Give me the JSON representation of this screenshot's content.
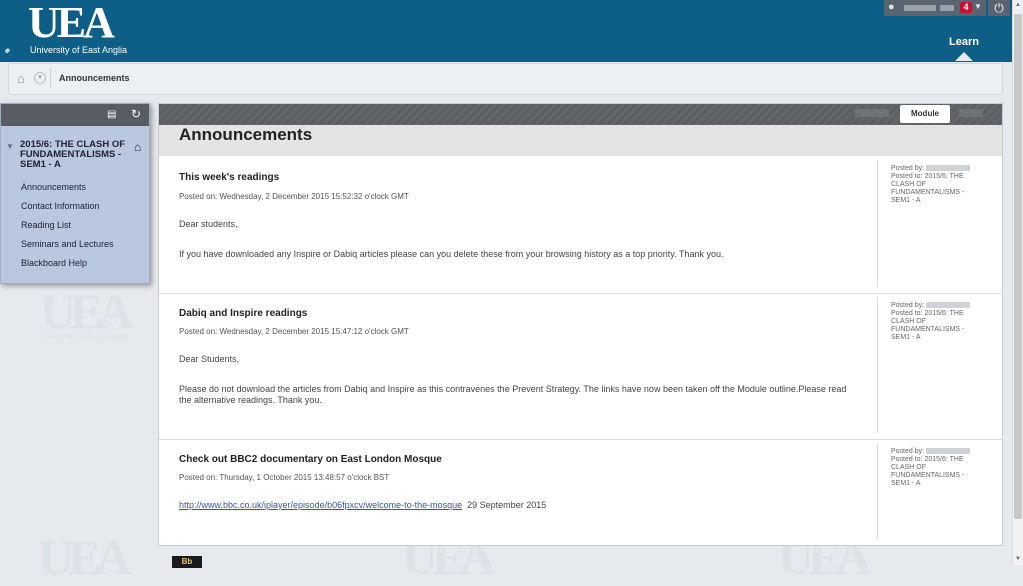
{
  "header": {
    "logo_text": "UEA",
    "logo_sub": "University of East Anglia",
    "notification_count": "4",
    "learn_tab": "Learn"
  },
  "breadcrumb": {
    "current": "Announcements"
  },
  "course_menu": {
    "course_title": "2015/6: THE CLASH OF FUNDAMENTALISMS - SEM1 - A",
    "items": [
      {
        "label": "Announcements"
      },
      {
        "label": "Contact Information"
      },
      {
        "label": "Reading List"
      },
      {
        "label": "Seminars and Lectures"
      },
      {
        "label": "Blackboard Help"
      }
    ]
  },
  "content": {
    "tab_module": "Module",
    "page_title": "Announcements",
    "announcements": [
      {
        "title": "This week's readings",
        "posted_on": "Posted on: Wednesday, 2 December 2015 15:52:32 o'clock GMT",
        "body": [
          "Dear students,",
          "If you have downloaded any Inspire or Dabiq articles please can you delete these from your browsing history as a top priority. Thank you."
        ],
        "posted_by_label": "Posted by:",
        "posted_to": "Posted to: 2015/6: THE CLASH OF FUNDAMENTALISMS - SEM1 - A"
      },
      {
        "title": "Dabiq and Inspire readings",
        "posted_on": "Posted on: Wednesday, 2 December 2015 15:47:12 o'clock GMT",
        "body": [
          "Dear Students,",
          "Please do not download the articles from Dabiq and Inspire as this contravenes the Prevent Strategy. The links have now been taken off the Module outline.Please read the alternative readings. Thank you."
        ],
        "posted_by_label": "Posted by:",
        "posted_to": "Posted to: 2015/6: THE CLASH OF FUNDAMENTALISMS - SEM1 - A"
      },
      {
        "title": "Check out BBC2 documentary on East London Mosque",
        "posted_on": "Posted on: Thursday, 1 October 2015 13:48:57 o'clock BST",
        "link": "http://www.bbc.co.uk/iplayer/episode/b06fpxcv/welcome-to-the-mosque",
        "link_suffix": "29 September 2015",
        "posted_by_label": "Posted by:",
        "posted_to": "Posted to: 2015/6: THE CLASH OF FUNDAMENTALISMS - SEM1 - A"
      }
    ]
  },
  "footer": {
    "blackboard_logo": "Bb"
  }
}
